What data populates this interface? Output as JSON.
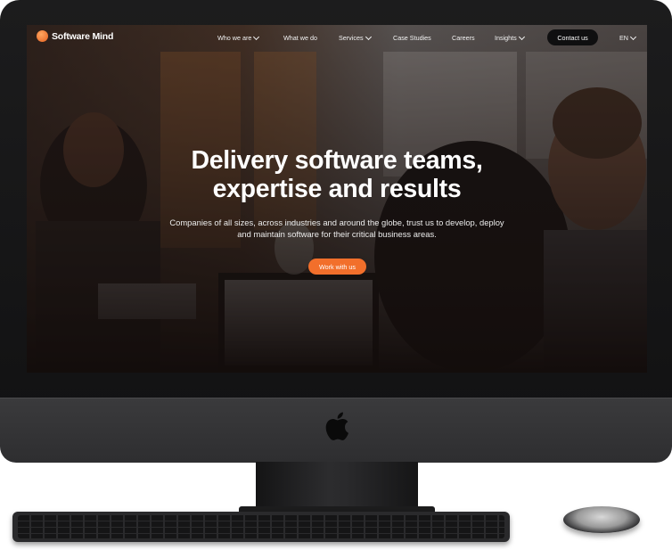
{
  "brand": {
    "name": "Software Mind",
    "logo_color": "#f26f2b"
  },
  "nav": {
    "items": [
      {
        "label": "Who we are",
        "has_dropdown": true
      },
      {
        "label": "What we do",
        "has_dropdown": false
      },
      {
        "label": "Services",
        "has_dropdown": true
      },
      {
        "label": "Case Studies",
        "has_dropdown": false
      },
      {
        "label": "Careers",
        "has_dropdown": false
      },
      {
        "label": "Insights",
        "has_dropdown": true
      }
    ],
    "contact_label": "Contact us",
    "language": "EN"
  },
  "hero": {
    "title_line1": "Delivery software teams,",
    "title_line2": "expertise and results",
    "subtitle_line1": "Companies of all sizes, across industries and around the globe, trust us to develop, deploy",
    "subtitle_line2": "and maintain software for their critical business areas.",
    "cta_label": "Work with us",
    "cta_color": "#f26f2b"
  },
  "device": {
    "logo_icon": "apple-logo-icon"
  }
}
